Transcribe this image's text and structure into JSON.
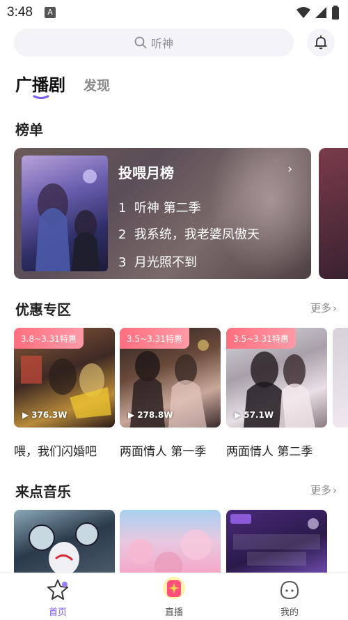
{
  "status_bar": {
    "time": "3:48"
  },
  "search": {
    "placeholder": "听神"
  },
  "tabs": [
    {
      "label": "广播剧",
      "active": true
    },
    {
      "label": "发现",
      "active": false
    }
  ],
  "ranking": {
    "section_title": "榜单",
    "card": {
      "title": "投喂月榜",
      "items": [
        {
          "rank": "1",
          "name": "听神 第二季"
        },
        {
          "rank": "2",
          "name": "我系统，我老婆凤傲天"
        },
        {
          "rank": "3",
          "name": "月光照不到"
        }
      ]
    }
  },
  "promo": {
    "section_title": "优惠专区",
    "more_label": "更多",
    "items": [
      {
        "badge": "3.8~3.31特惠",
        "plays": "376.3W",
        "name": "喂，我们闪婚吧"
      },
      {
        "badge": "3.5~3.31特惠",
        "plays": "278.8W",
        "name": "两面情人 第一季"
      },
      {
        "badge": "3.5~3.31特惠",
        "plays": "57.1W",
        "name": "两面情人 第二季"
      }
    ]
  },
  "music": {
    "section_title": "来点音乐",
    "more_label": "更多"
  },
  "bottom_nav": [
    {
      "label": "首页",
      "icon": "star-home-icon",
      "active": true
    },
    {
      "label": "直播",
      "icon": "live-gift-icon",
      "active": false
    },
    {
      "label": "我的",
      "icon": "profile-face-icon",
      "active": false
    }
  ],
  "colors": {
    "accent": "#7b5cf0",
    "active_nav": "#7b5cf0",
    "promo_badge": "#ff7a88"
  }
}
